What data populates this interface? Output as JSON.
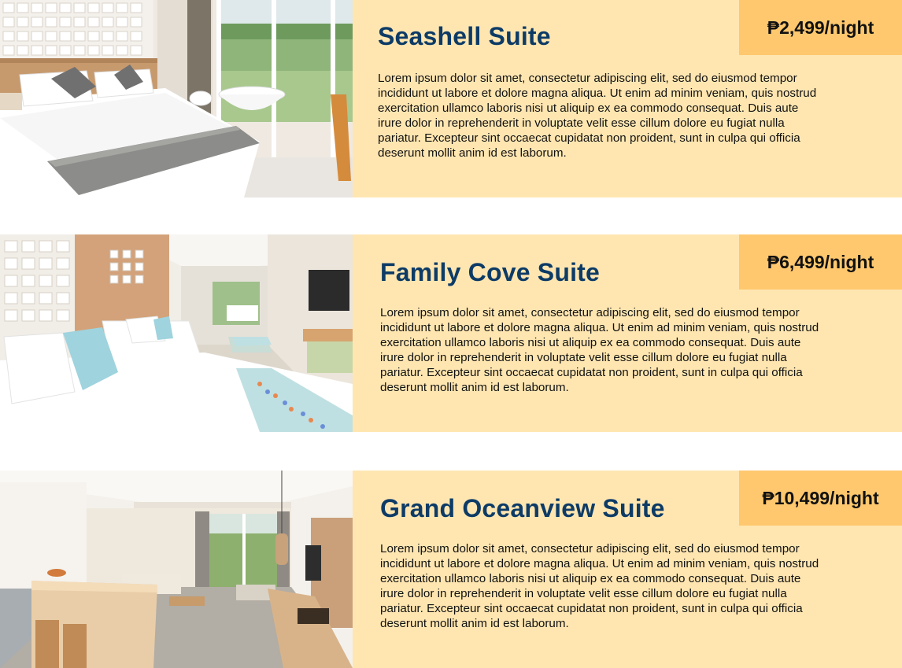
{
  "rooms": [
    {
      "name": "Seashell Suite",
      "price": "₱2,499/night",
      "description": "Lorem ipsum dolor sit amet, consectetur adipiscing elit, sed do eiusmod tempor incididunt ut labore et dolore magna aliqua. Ut enim ad minim veniam, quis nostrud exercitation ullamco laboris nisi ut aliquip ex ea commodo consequat. Duis aute irure dolor in reprehenderit in voluptate velit esse cillum dolore eu fugiat nulla pariatur. Excepteur sint occaecat cupidatat non proident, sunt in culpa qui officia deserunt mollit anim id est laborum."
    },
    {
      "name": "Family Cove Suite",
      "price": "₱6,499/night",
      "description": "Lorem ipsum dolor sit amet, consectetur adipiscing elit, sed do eiusmod tempor incididunt ut labore et dolore magna aliqua. Ut enim ad minim veniam, quis nostrud exercitation ullamco laboris nisi ut aliquip ex ea commodo consequat. Duis aute irure dolor in reprehenderit in voluptate velit esse cillum dolore eu fugiat nulla pariatur. Excepteur sint occaecat cupidatat non proident, sunt in culpa qui officia deserunt mollit anim id est laborum."
    },
    {
      "name": "Grand Oceanview Suite",
      "price": "₱10,499/night",
      "description": "Lorem ipsum dolor sit amet, consectetur adipiscing elit, sed do eiusmod tempor incididunt ut labore et dolore magna aliqua. Ut enim ad minim veniam, quis nostrud exercitation ullamco laboris nisi ut aliquip ex ea commodo consequat. Duis aute irure dolor in reprehenderit in voluptate velit esse cillum dolore eu fugiat nulla pariatur. Excepteur sint occaecat cupidatat non proident, sunt in culpa qui officia deserunt mollit anim id est laborum."
    }
  ],
  "colors": {
    "card_background": "#ffe6b1",
    "price_badge": "#ffc86e",
    "title": "#0d3b66",
    "text": "#111111"
  }
}
